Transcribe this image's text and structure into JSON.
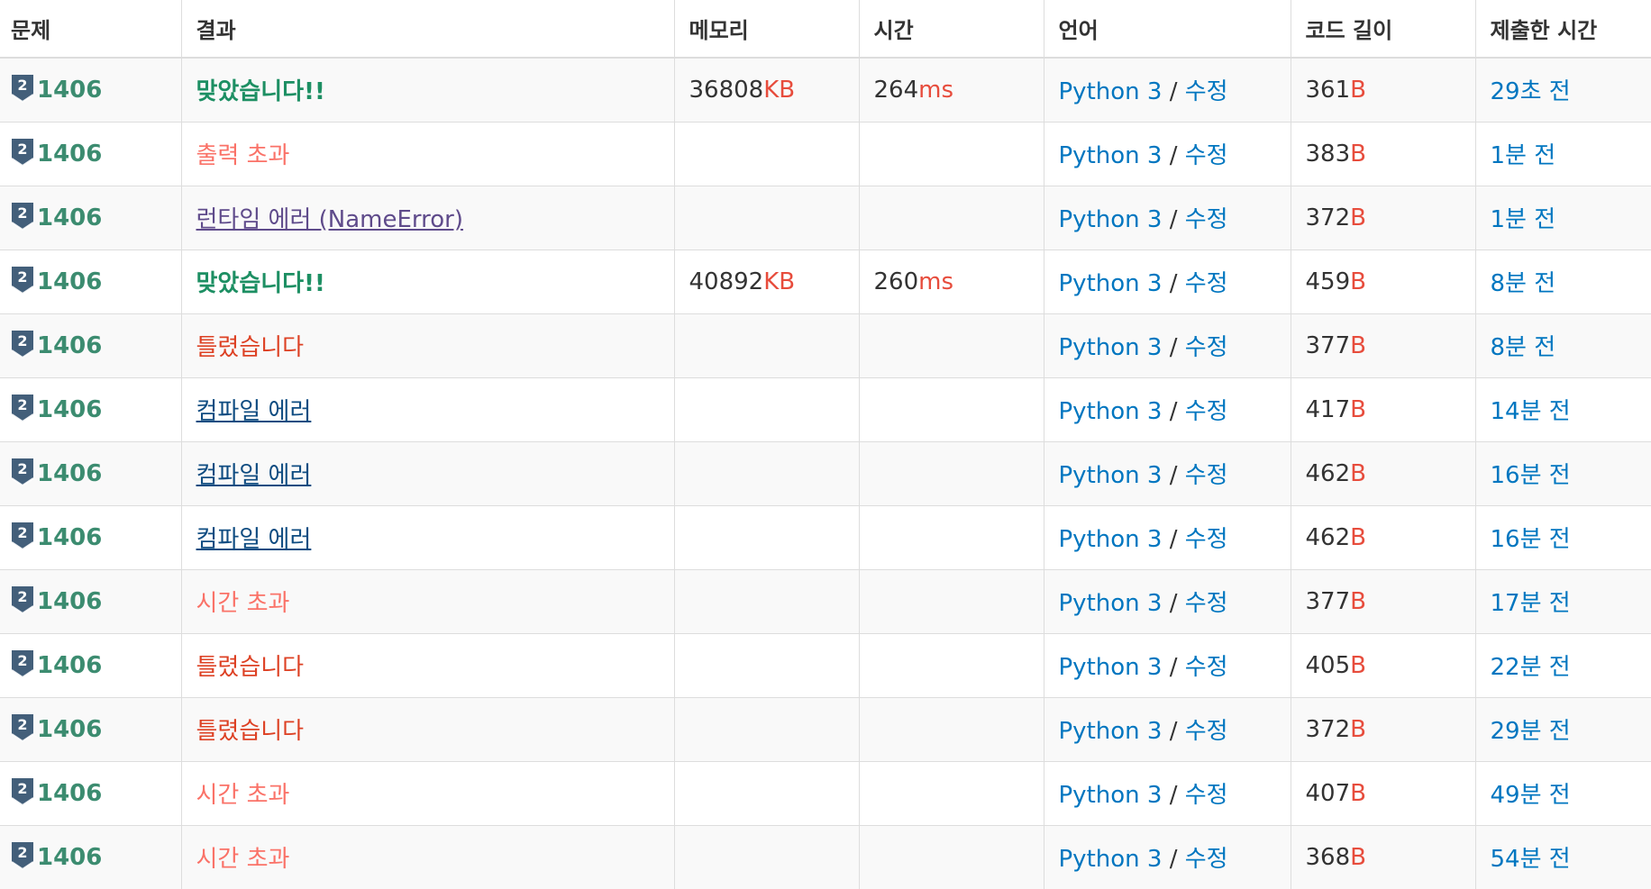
{
  "headers": {
    "problem": "문제",
    "result": "결과",
    "memory": "메모리",
    "time": "시간",
    "language": "언어",
    "code_length": "코드 길이",
    "submitted": "제출한 시간"
  },
  "tier_badge": {
    "level": "2",
    "icon": "silver-tier-shield-icon",
    "color": "#435f7a"
  },
  "colors": {
    "accepted": "#1d8f63",
    "output_exceeded": "#fa7268",
    "runtime_error": "#5f4b8b",
    "wrong_answer": "#dd4124",
    "compile_error": "#0f4c81",
    "time_limit": "#fa7268",
    "unit": "#e74c3c",
    "link": "#0076c0"
  },
  "rows": [
    {
      "problem": "1406",
      "result": "맞았습니다!!",
      "result_type": "ac",
      "memory": "36808",
      "memory_unit": "KB",
      "time": "264",
      "time_unit": "ms",
      "language": "Python 3",
      "slash": " / ",
      "edit": "수정",
      "length": "361",
      "length_unit": "B",
      "submitted": "29초 전"
    },
    {
      "problem": "1406",
      "result": "출력 초과",
      "result_type": "ole",
      "memory": "",
      "memory_unit": "",
      "time": "",
      "time_unit": "",
      "language": "Python 3",
      "slash": " / ",
      "edit": "수정",
      "length": "383",
      "length_unit": "B",
      "submitted": "1분 전"
    },
    {
      "problem": "1406",
      "result": "런타임 에러 (NameError)",
      "result_type": "rte",
      "memory": "",
      "memory_unit": "",
      "time": "",
      "time_unit": "",
      "language": "Python 3",
      "slash": " / ",
      "edit": "수정",
      "length": "372",
      "length_unit": "B",
      "submitted": "1분 전"
    },
    {
      "problem": "1406",
      "result": "맞았습니다!!",
      "result_type": "ac",
      "memory": "40892",
      "memory_unit": "KB",
      "time": "260",
      "time_unit": "ms",
      "language": "Python 3",
      "slash": " / ",
      "edit": "수정",
      "length": "459",
      "length_unit": "B",
      "submitted": "8분 전"
    },
    {
      "problem": "1406",
      "result": "틀렸습니다",
      "result_type": "wa",
      "memory": "",
      "memory_unit": "",
      "time": "",
      "time_unit": "",
      "language": "Python 3",
      "slash": " / ",
      "edit": "수정",
      "length": "377",
      "length_unit": "B",
      "submitted": "8분 전"
    },
    {
      "problem": "1406",
      "result": "컴파일 에러",
      "result_type": "ce",
      "memory": "",
      "memory_unit": "",
      "time": "",
      "time_unit": "",
      "language": "Python 3",
      "slash": " / ",
      "edit": "수정",
      "length": "417",
      "length_unit": "B",
      "submitted": "14분 전"
    },
    {
      "problem": "1406",
      "result": "컴파일 에러",
      "result_type": "ce",
      "memory": "",
      "memory_unit": "",
      "time": "",
      "time_unit": "",
      "language": "Python 3",
      "slash": " / ",
      "edit": "수정",
      "length": "462",
      "length_unit": "B",
      "submitted": "16분 전"
    },
    {
      "problem": "1406",
      "result": "컴파일 에러",
      "result_type": "ce",
      "memory": "",
      "memory_unit": "",
      "time": "",
      "time_unit": "",
      "language": "Python 3",
      "slash": " / ",
      "edit": "수정",
      "length": "462",
      "length_unit": "B",
      "submitted": "16분 전"
    },
    {
      "problem": "1406",
      "result": "시간 초과",
      "result_type": "tle",
      "memory": "",
      "memory_unit": "",
      "time": "",
      "time_unit": "",
      "language": "Python 3",
      "slash": " / ",
      "edit": "수정",
      "length": "377",
      "length_unit": "B",
      "submitted": "17분 전"
    },
    {
      "problem": "1406",
      "result": "틀렸습니다",
      "result_type": "wa",
      "memory": "",
      "memory_unit": "",
      "time": "",
      "time_unit": "",
      "language": "Python 3",
      "slash": " / ",
      "edit": "수정",
      "length": "405",
      "length_unit": "B",
      "submitted": "22분 전"
    },
    {
      "problem": "1406",
      "result": "틀렸습니다",
      "result_type": "wa",
      "memory": "",
      "memory_unit": "",
      "time": "",
      "time_unit": "",
      "language": "Python 3",
      "slash": " / ",
      "edit": "수정",
      "length": "372",
      "length_unit": "B",
      "submitted": "29분 전"
    },
    {
      "problem": "1406",
      "result": "시간 초과",
      "result_type": "tle",
      "memory": "",
      "memory_unit": "",
      "time": "",
      "time_unit": "",
      "language": "Python 3",
      "slash": " / ",
      "edit": "수정",
      "length": "407",
      "length_unit": "B",
      "submitted": "49분 전"
    },
    {
      "problem": "1406",
      "result": "시간 초과",
      "result_type": "tle",
      "memory": "",
      "memory_unit": "",
      "time": "",
      "time_unit": "",
      "language": "Python 3",
      "slash": " / ",
      "edit": "수정",
      "length": "368",
      "length_unit": "B",
      "submitted": "54분 전"
    }
  ]
}
